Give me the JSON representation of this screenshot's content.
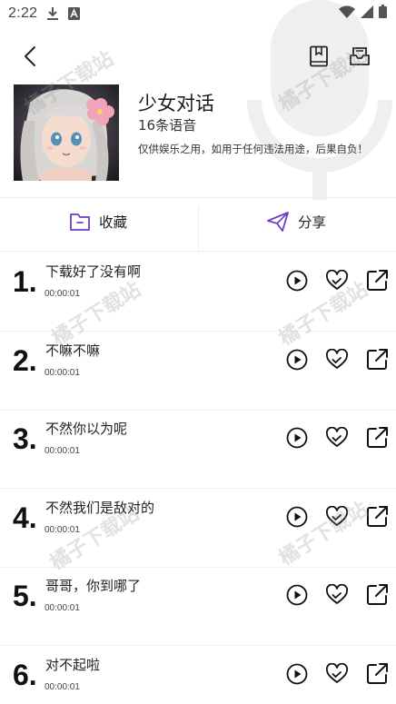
{
  "status_bar": {
    "time": "2:22",
    "icons": [
      "download-icon",
      "a-badge-icon",
      "wifi-icon",
      "signal-icon",
      "battery-icon"
    ]
  },
  "header": {
    "back_icon": "chevron-left-icon",
    "right_icons": [
      "book-icon",
      "inbox-icon"
    ]
  },
  "album": {
    "title": "少女对话",
    "count": "16条语音",
    "description": "仅供娱乐之用，如用于任何违法用途，后果自负！"
  },
  "actions": {
    "favorite_label": "收藏",
    "share_label": "分享",
    "accent_color": "#6a3fc7"
  },
  "watermark_text": "橘子下载站",
  "voices": [
    {
      "num": "1.",
      "title": "下载好了没有啊",
      "duration": "00:00:01"
    },
    {
      "num": "2.",
      "title": "不嘛不嘛",
      "duration": "00:00:01"
    },
    {
      "num": "3.",
      "title": "不然你以为呢",
      "duration": "00:00:01"
    },
    {
      "num": "4.",
      "title": "不然我们是敌对的",
      "duration": "00:00:01"
    },
    {
      "num": "5.",
      "title": "哥哥，你到哪了",
      "duration": "00:00:01"
    },
    {
      "num": "6.",
      "title": "对不起啦",
      "duration": "00:00:01"
    }
  ],
  "row_icons": [
    "play-icon",
    "heart-check-icon",
    "share-out-icon"
  ]
}
